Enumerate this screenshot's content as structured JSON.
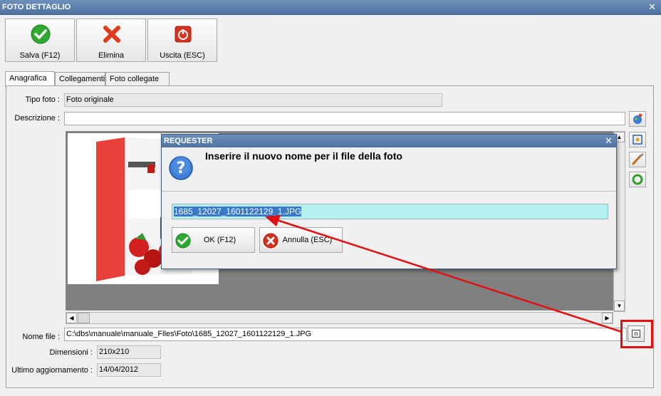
{
  "window": {
    "title": "FOTO DETTAGLIO"
  },
  "toolbar": {
    "save_label": "Salva (F12)",
    "delete_label": "Elimina",
    "exit_label": "Uscita (ESC)"
  },
  "tabs": [
    {
      "label": "Anagrafica",
      "active": true
    },
    {
      "label": "Collegamenti",
      "active": false
    },
    {
      "label": "Foto collegate",
      "active": false
    }
  ],
  "form": {
    "tipo_label": "Tipo foto :",
    "tipo_value": "Foto originale",
    "descrizione_label": "Descrizione :",
    "descrizione_value": "",
    "nomefile_label": "Nome file :",
    "nomefile_value": "C:\\dbs\\manuale\\manuale_Files\\Foto\\1685_12027_1601122129_1.JPG",
    "dimensioni_label": "Dimensioni :",
    "dimensioni_value": "210x210",
    "aggiornamento_label": "Ultimo aggiornamento :",
    "aggiornamento_value": "14/04/2012"
  },
  "dialog": {
    "title": "REQUESTER",
    "message": "Inserire il nuovo nome per il file della foto",
    "input_value": "1685_12027_1601122129_1.JPG",
    "ok_label": "OK (F12)",
    "cancel_label": "Annulla (ESC)"
  },
  "rename_button": {
    "glyph": "n"
  },
  "colors": {
    "titlebar": "#5b7fae",
    "highlight": "#e01010",
    "input_bg": "#b5f0f0"
  }
}
